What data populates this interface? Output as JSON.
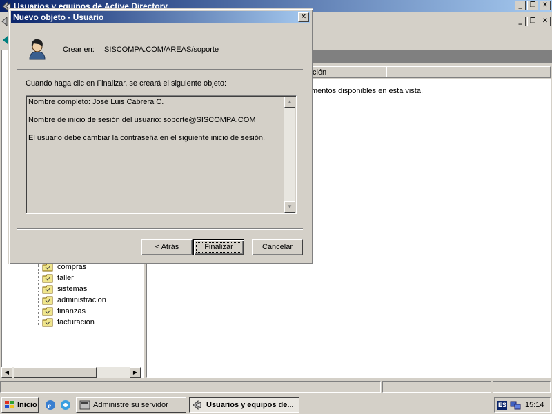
{
  "main_window": {
    "title": "Usuarios y equipos de Active Directory",
    "column_header_partial": "ción",
    "content_message_partial": "mentos disponibles en esta vista."
  },
  "tree": {
    "items": [
      {
        "label": "compras"
      },
      {
        "label": "taller"
      },
      {
        "label": "sistemas"
      },
      {
        "label": "administracion"
      },
      {
        "label": "finanzas"
      },
      {
        "label": "facturacion"
      }
    ]
  },
  "dialog": {
    "title": "Nuevo objeto - Usuario",
    "create_in_label": "Crear en:",
    "create_in_path": "SISCOMPA.COM/AREAS/soporte",
    "instruction": "Cuando haga clic en Finalizar, se creará el siguiente objeto:",
    "summary_lines": [
      "Nombre completo: José Luis Cabrera C.",
      "Nombre de inicio de sesión del usuario: soporte@SISCOMPA.COM",
      "El usuario debe cambiar la contraseña en el siguiente inicio de sesión."
    ],
    "buttons": {
      "back": "< Atrás",
      "finish": "Finalizar",
      "cancel": "Cancelar"
    }
  },
  "taskbar": {
    "start_label": "Inicio",
    "tasks": [
      {
        "label": "Administre su servidor"
      },
      {
        "label": "Usuarios y equipos de..."
      }
    ],
    "language": "ES",
    "clock": "15:14"
  },
  "colors": {
    "title_active_start": "#0a246a",
    "title_active_end": "#a6caf0",
    "face": "#d4d0c8"
  }
}
